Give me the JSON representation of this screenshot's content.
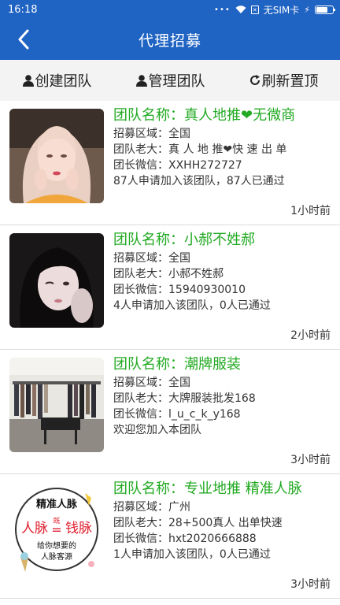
{
  "status_bar": {
    "time": "16:18",
    "sim_label": "无SIM卡",
    "icons": [
      "dots-icon",
      "wifi-icon",
      "no-sim-icon",
      "charging-icon",
      "battery-icon"
    ]
  },
  "nav": {
    "title": "代理招募"
  },
  "toolbar": {
    "create_label": "创建团队",
    "manage_label": "管理团队",
    "refresh_label": "刷新置顶"
  },
  "teams": [
    {
      "name": "团队名称：真人地推❤无微商",
      "region": "招募区域：全国",
      "leader": "团队老大：真 人 地 推❤快 速 出 单",
      "wechat": "团长微信：XXHH272727",
      "stats": "87人申请加入该团队，87人已通过",
      "time": "1小时前"
    },
    {
      "name": "团队名称：小郝不姓郝",
      "region": "招募区域：全国",
      "leader": "团队老大：小郝不姓郝",
      "wechat": "团长微信：15940930010",
      "stats": "4人申请加入该团队，0人已通过",
      "time": "2小时前"
    },
    {
      "name": "团队名称：潮牌服装",
      "region": "招募区域：全国",
      "leader": "团队老大：大牌服装批发168",
      "wechat": "团长微信：l_u_c_k_y168",
      "stats": "欢迎您加入本团队",
      "time": "3小时前"
    },
    {
      "name": "团队名称：专业地推 精准人脉",
      "region": "招募区域：广州",
      "leader": "团队老大：28+500真人 出单快速",
      "wechat": "团长微信：hxt2020666888",
      "stats": "1人申请加入该团队，0人已通过",
      "time": "3小时前",
      "thumb_text": {
        "top": "精准人脉",
        "left": "人脉",
        "mid": "既",
        "eq": "=",
        "right": "钱脉",
        "line1": "给你想要的",
        "line2": "人脉客源"
      }
    }
  ],
  "colors": {
    "primary": "#1f63c3",
    "team_name": "#22aa22",
    "thumb_red": "#e02030"
  }
}
